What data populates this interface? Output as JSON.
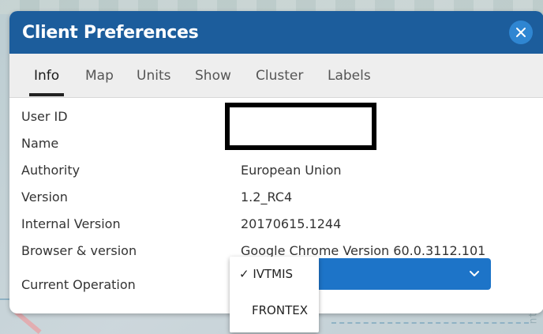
{
  "dialog": {
    "title": "Client Preferences",
    "close_icon": "close-icon"
  },
  "tabs": [
    {
      "label": "Info",
      "active": true
    },
    {
      "label": "Map",
      "active": false
    },
    {
      "label": "Units",
      "active": false
    },
    {
      "label": "Show",
      "active": false
    },
    {
      "label": "Cluster",
      "active": false
    },
    {
      "label": "Labels",
      "active": false
    }
  ],
  "info": {
    "rows": [
      {
        "label": "User ID",
        "value": ""
      },
      {
        "label": "Name",
        "value": ""
      },
      {
        "label": "Authority",
        "value": "European Union"
      },
      {
        "label": "Version",
        "value": "1.2_RC4"
      },
      {
        "label": "Internal Version",
        "value": "20170615.1244"
      },
      {
        "label": "Browser & version",
        "value": "Google Chrome Version 60.0.3112.101"
      },
      {
        "label": "Current Operation",
        "value": ""
      }
    ]
  },
  "operation_select": {
    "selected": "IVTMIS",
    "options": [
      "✓ IVTMIS",
      "FRONTEX"
    ],
    "chevron_icon": "chevron-down-icon"
  },
  "colors": {
    "header": "#1c5d9c",
    "close_button": "#2f86d2",
    "select": "#1d74c8"
  }
}
